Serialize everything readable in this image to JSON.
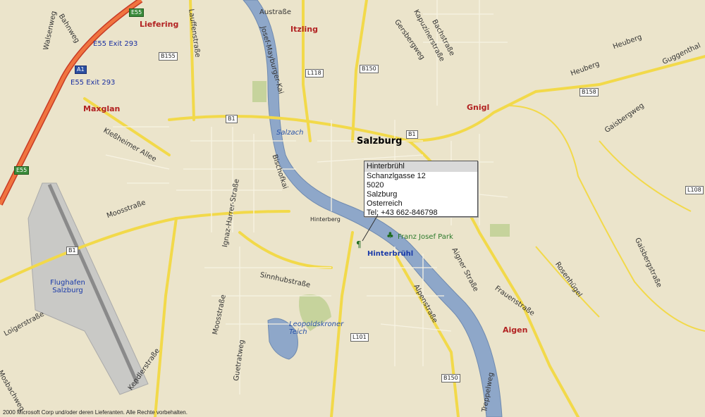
{
  "map": {
    "city_label": "Salzburg",
    "districts": [
      "Liefering",
      "Itzling",
      "Maxglan",
      "Gnigl",
      "Aigen"
    ],
    "streets": [
      "Austraße",
      "Josef-Mayburger-Kai",
      "Lauffenstraße",
      "Bahnweg",
      "Walsenweg",
      "Kleßheimer Allee",
      "Moosstraße",
      "Moosstraße",
      "Sinnhubstraße",
      "Bischofkai",
      "Ignaz-Harrer-Straße",
      "Kendlerstraße",
      "Loigerstraße",
      "Guetratweg",
      "Alpenstraße",
      "Aigner Straße",
      "Kapuzinerstraße",
      "Bachstraße",
      "Heuberg",
      "Heuberg",
      "Guggenthal",
      "Gaisbergweg",
      "Gaisbergstraße",
      "Rosenhügel",
      "Gersbergweg",
      "Frauenstraße",
      "Treppelweg",
      "Mosbachweg"
    ],
    "water_labels": [
      "Salzach",
      "Leopoldskroner Teich"
    ],
    "places": [
      "Flughafen Salzburg",
      "Franz Josef Park",
      "Hinterbrühl"
    ],
    "road_shields": [
      "E55",
      "B155",
      "L118",
      "B150",
      "B1",
      "B158",
      "L108",
      "B1",
      "E55",
      "A1",
      "L101",
      "B150",
      "B1"
    ],
    "exits": [
      "E55 Exit 293",
      "E55 Exit 293"
    ],
    "poi_small_label": "Hinterberg",
    "colors": {
      "background": "#ebe4cb",
      "road": "#f5e36b",
      "motorway": "#e8452c",
      "water": "#8fa8c8",
      "park": "#c7d6a0",
      "airport": "#c4c4c4"
    }
  },
  "popup": {
    "name": "Hinterbrühl",
    "lines": [
      "Schanzlgasse 12",
      "5020",
      "Salzburg",
      "Osterreich",
      "Tel: +43 662-846798"
    ]
  },
  "copyright": "2000 Microsoft Corp und/oder deren Lieferanten. Alle Rechte vorbehalten."
}
